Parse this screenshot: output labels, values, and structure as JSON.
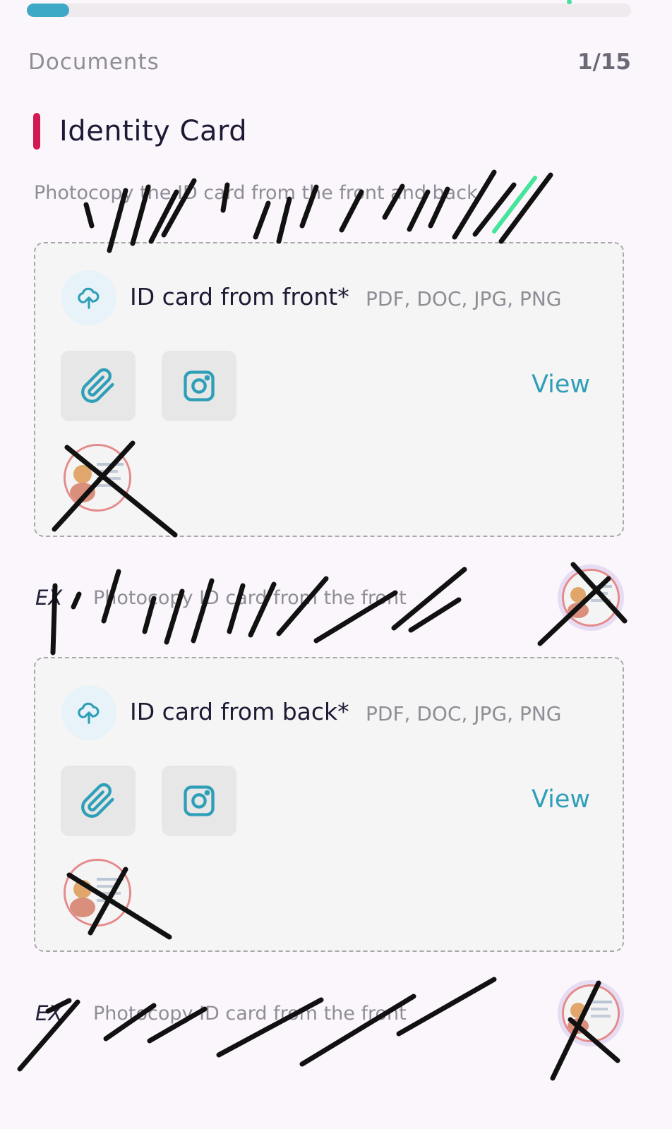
{
  "progress": {
    "value": 0.07
  },
  "header": {
    "title": "Documents",
    "page_counter": "1/15"
  },
  "section": {
    "title": "Identity Card",
    "description": "Photocopy the ID card from the front and back",
    "accent_color": "#d11a53"
  },
  "fields": [
    {
      "label": "ID card from front*",
      "formats": "PDF, DOC, JPG, PNG",
      "view_label": "View",
      "example_prefix": "EX",
      "example_text": "Photocopy ID card from the front"
    },
    {
      "label": "ID card from back*",
      "formats": "PDF, DOC, JPG, PNG",
      "view_label": "View",
      "example_prefix": "EX",
      "example_text": "Photocopy ID card from the front"
    }
  ],
  "icons": [
    "cloud-upload-icon",
    "paperclip-icon",
    "camera-icon"
  ],
  "colors": {
    "primary": "#3ea9c7",
    "link": "#2f9fb8",
    "card_bg": "#f5f5f5"
  }
}
